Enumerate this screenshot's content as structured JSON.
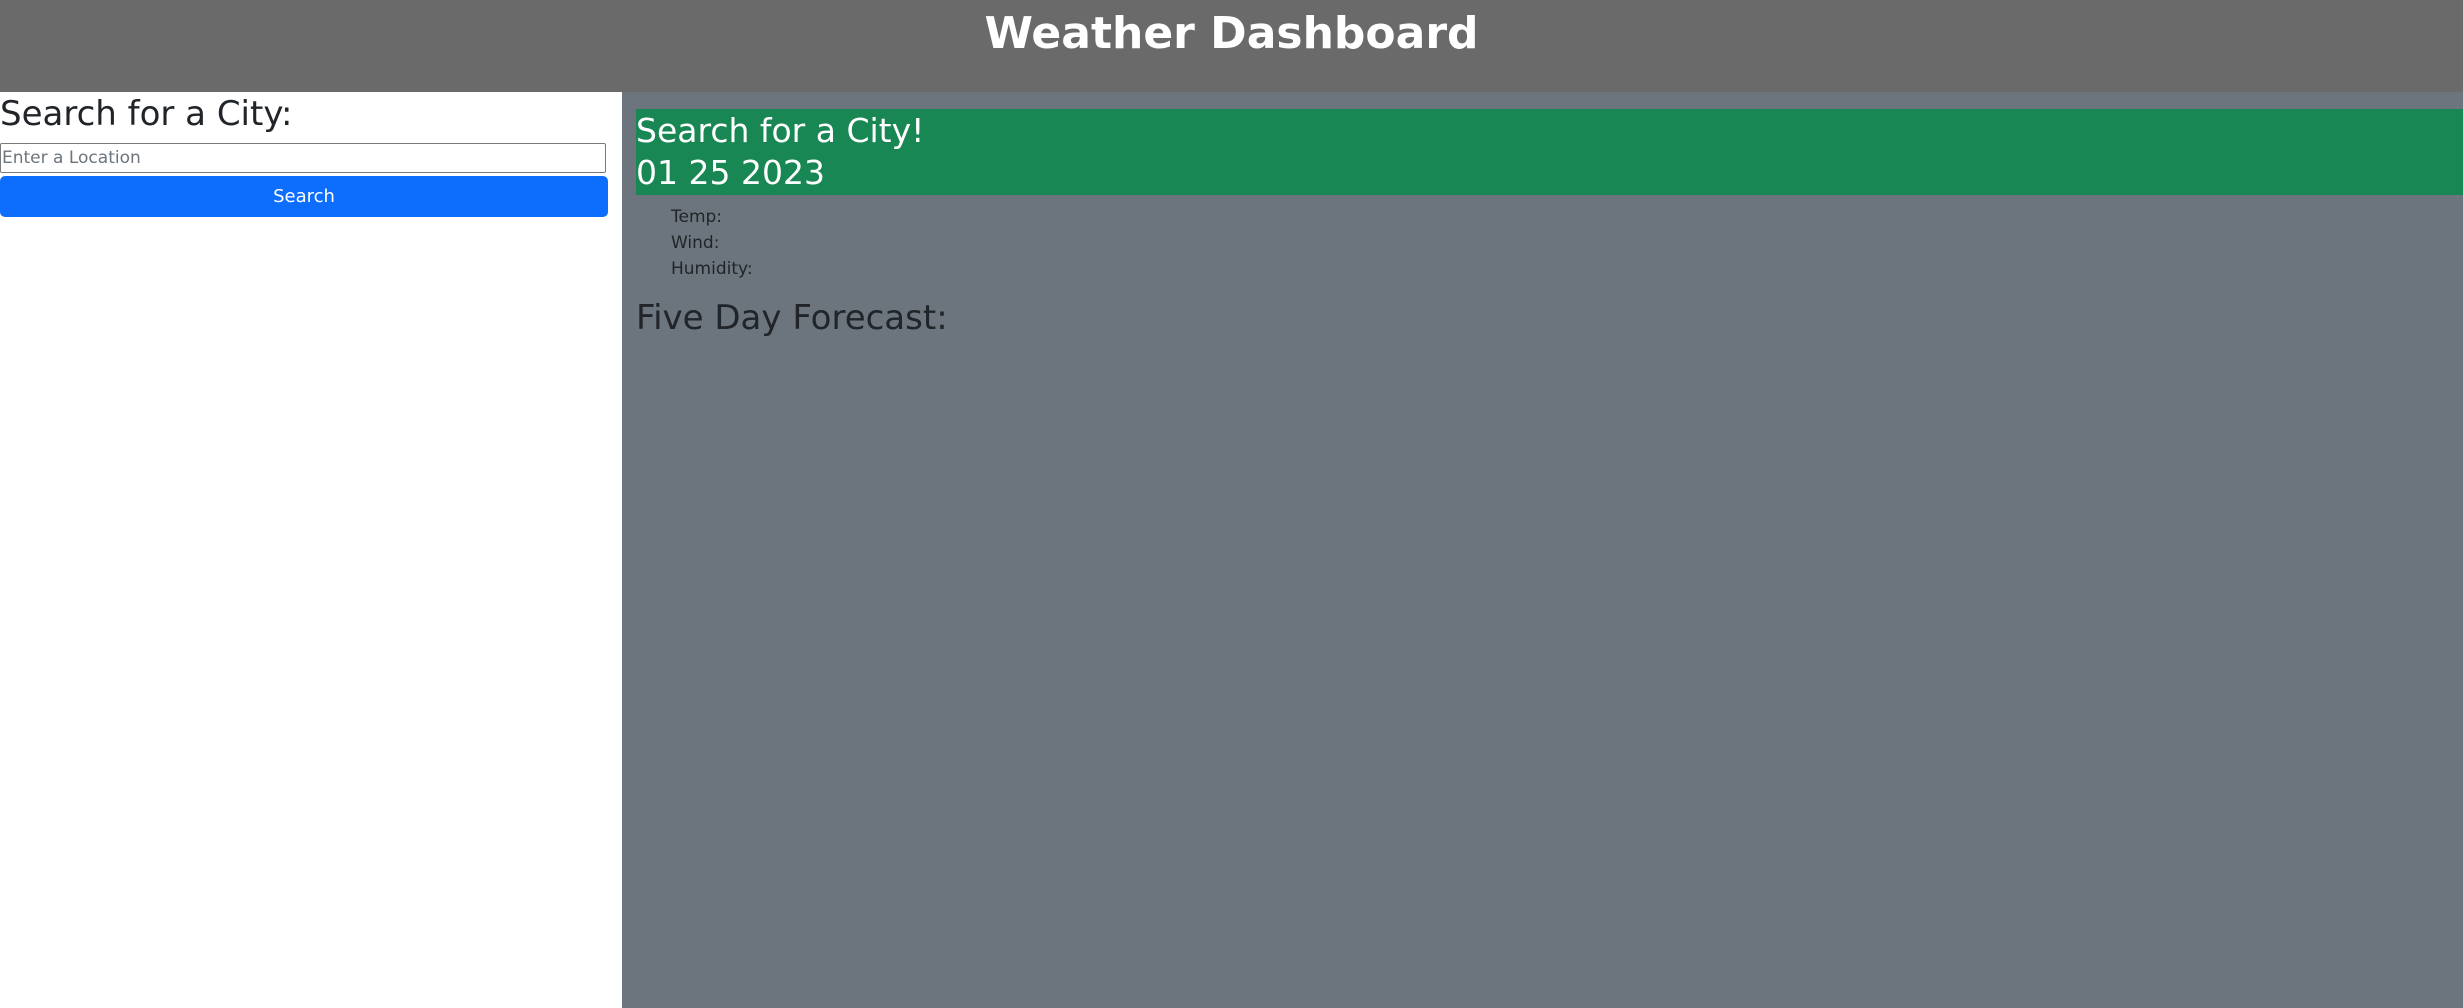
{
  "header": {
    "title": "Weather Dashboard"
  },
  "sidebar": {
    "heading": "Search for a City:",
    "search": {
      "placeholder": "Enter a Location",
      "value": ""
    },
    "search_button_label": "Search"
  },
  "main": {
    "current": {
      "city": "Search for a City!",
      "date": "01 25 2023"
    },
    "conditions": {
      "temp_label": "Temp:",
      "wind_label": "Wind:",
      "humidity_label": "Humidity:"
    },
    "forecast_title": "Five Day Forecast:"
  },
  "colors": {
    "header_bg": "#6a6a6a",
    "main_bg": "#6c757d",
    "current_card_bg": "#198754",
    "button_bg": "#0d6efd"
  }
}
